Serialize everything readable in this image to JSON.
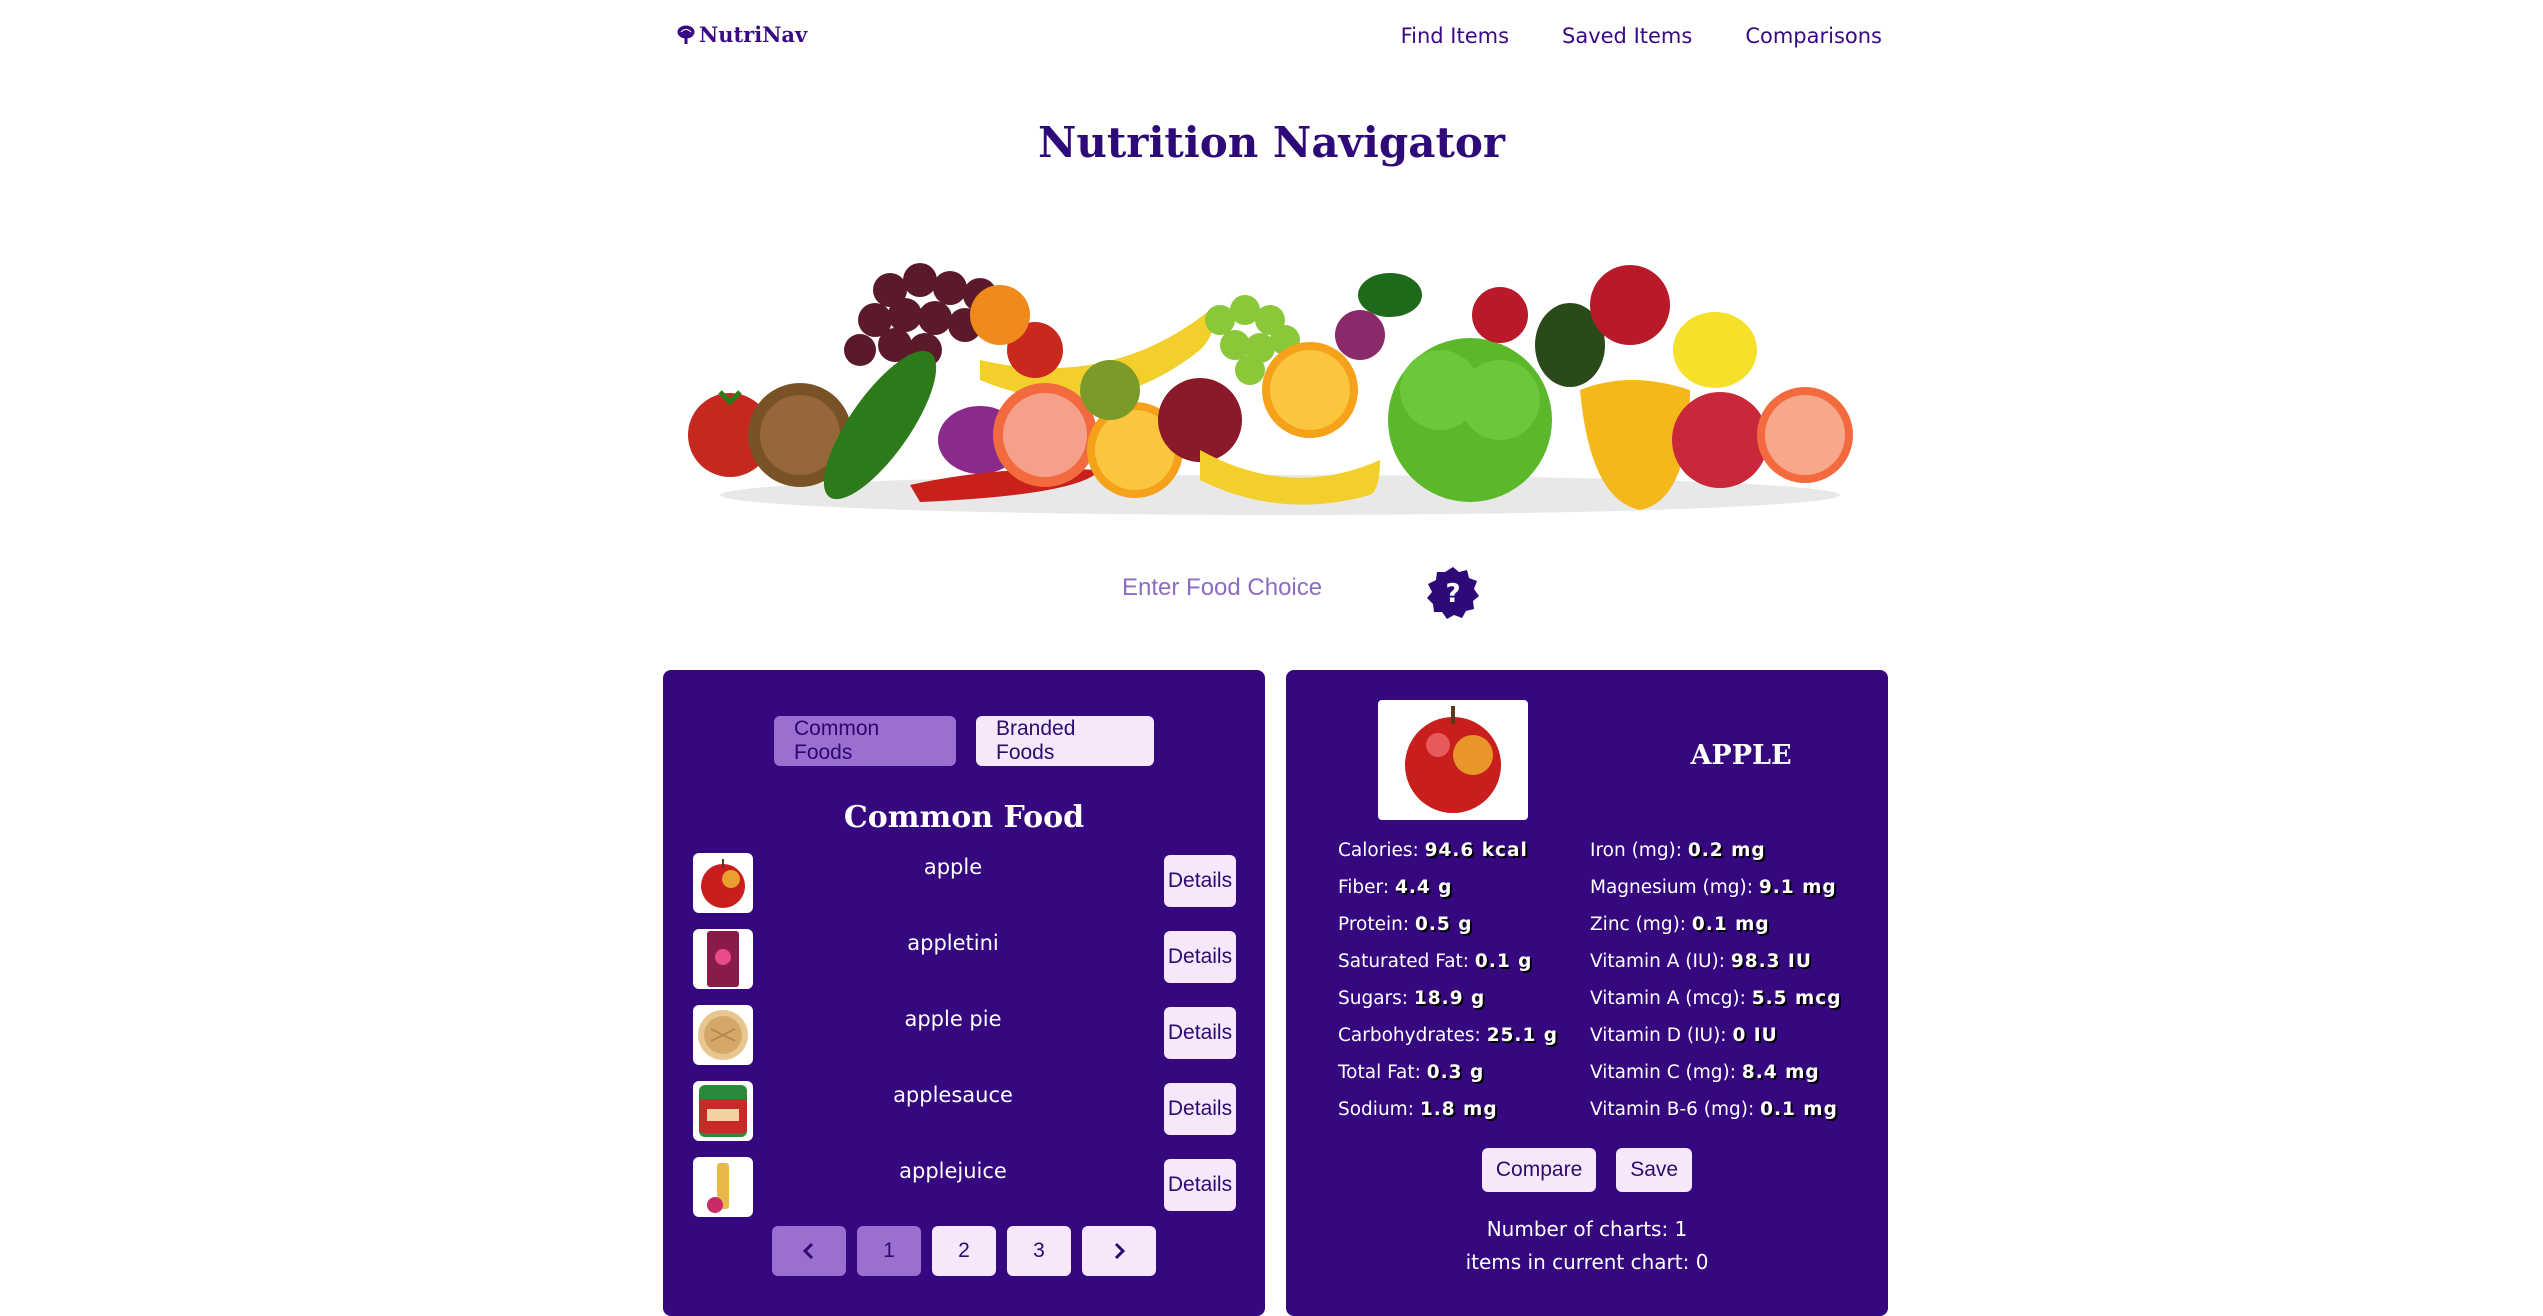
{
  "brand": {
    "name": "NutriNav"
  },
  "nav": {
    "links": [
      "Find Items",
      "Saved Items",
      "Comparisons"
    ]
  },
  "title": "Nutrition Navigator",
  "search": {
    "placeholder": "Enter Food Choice",
    "help_icon": "question-badge-icon"
  },
  "list_panel": {
    "tabs": [
      "Common Foods",
      "Branded Foods"
    ],
    "active_tab": "Common Foods",
    "heading": "Common Food",
    "details_label": "Details",
    "items": [
      {
        "name": "apple"
      },
      {
        "name": "appletini"
      },
      {
        "name": "apple pie"
      },
      {
        "name": "applesauce"
      },
      {
        "name": "applejuice"
      }
    ],
    "pagination": {
      "prev_icon": "chevron-left-icon",
      "pages": [
        "1",
        "2",
        "3"
      ],
      "current": "1",
      "next_icon": "chevron-right-icon"
    }
  },
  "detail_panel": {
    "name": "APPLE",
    "nutrients_left": [
      {
        "label": "Calories:",
        "value": "94.6 kcal"
      },
      {
        "label": "Fiber:",
        "value": "4.4 g"
      },
      {
        "label": "Protein:",
        "value": "0.5 g"
      },
      {
        "label": "Saturated Fat:",
        "value": "0.1 g"
      },
      {
        "label": "Sugars:",
        "value": "18.9 g"
      },
      {
        "label": "Carbohydrates:",
        "value": "25.1 g"
      },
      {
        "label": "Total Fat:",
        "value": "0.3 g"
      },
      {
        "label": "Sodium:",
        "value": "1.8 mg"
      }
    ],
    "nutrients_right": [
      {
        "label": "Iron (mg):",
        "value": "0.2 mg"
      },
      {
        "label": "Magnesium (mg):",
        "value": "9.1 mg"
      },
      {
        "label": "Zinc (mg):",
        "value": "0.1 mg"
      },
      {
        "label": "Vitamin A (IU):",
        "value": "98.3 IU"
      },
      {
        "label": "Vitamin A (mcg):",
        "value": "5.5 mcg"
      },
      {
        "label": "Vitamin D (IU):",
        "value": "0 IU"
      },
      {
        "label": "Vitamin C (mg):",
        "value": "8.4 mg"
      },
      {
        "label": "Vitamin B-6 (mg):",
        "value": "0.1 mg"
      }
    ],
    "compare_label": "Compare",
    "save_label": "Save",
    "charts_count_text": "Number of charts: 1",
    "current_chart_text": "items in current chart: 0"
  },
  "colors": {
    "panel": "#36087f",
    "accent_light": "#f7e7fb",
    "accent_dim": "#9b6fcf",
    "text_dark": "#2d0a6e"
  }
}
